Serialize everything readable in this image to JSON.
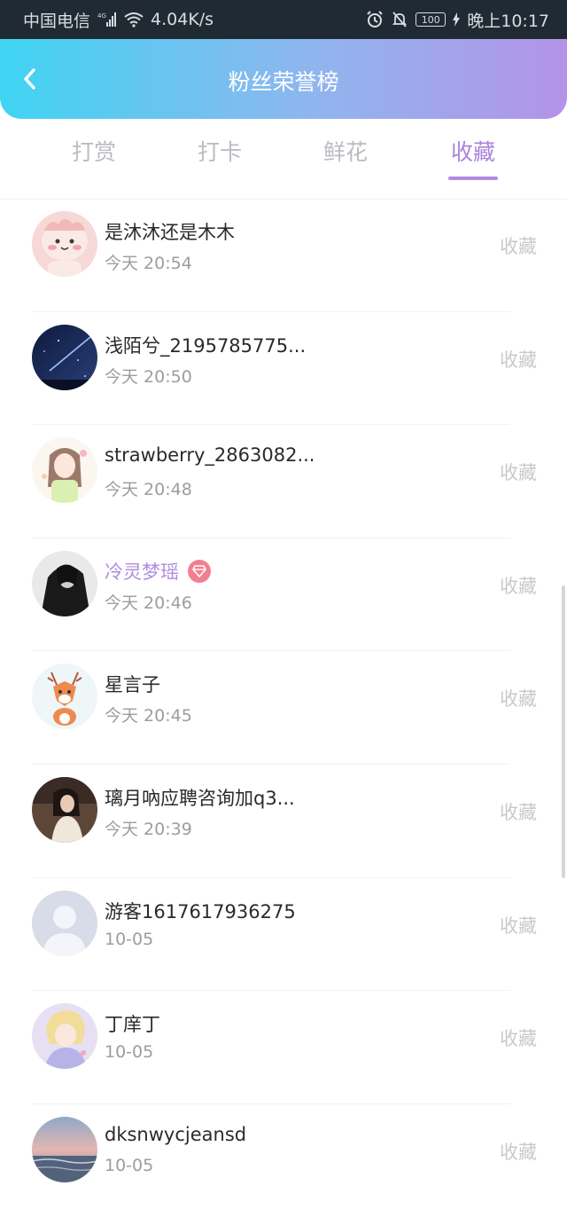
{
  "status_bar": {
    "carrier": "中国电信",
    "network": "4G",
    "speed": "4.04K/s",
    "battery": "100",
    "time": "晚上10:17"
  },
  "header": {
    "title": "粉丝荣誉榜",
    "back_icon": "chevron-left-icon"
  },
  "tabs": [
    {
      "label": "打赏",
      "active": false
    },
    {
      "label": "打卡",
      "active": false
    },
    {
      "label": "鲜花",
      "active": false
    },
    {
      "label": "收藏",
      "active": true
    }
  ],
  "fans": [
    {
      "name": "是沐沐还是木木",
      "time": "今天 20:54",
      "action": "收藏"
    },
    {
      "name": "浅陌兮_2195785775...",
      "time": "今天 20:50",
      "action": "收藏"
    },
    {
      "name": "strawberry_2863082...",
      "time": "今天 20:48",
      "action": "收藏"
    },
    {
      "name": "冷灵梦瑶",
      "time": "今天 20:46",
      "action": "收藏",
      "vip": true
    },
    {
      "name": "星言子",
      "time": "今天 20:45",
      "action": "收藏"
    },
    {
      "name": "璃月吶应聘咨询加q3...",
      "time": "今天 20:39",
      "action": "收藏"
    },
    {
      "name": "游客1617617936275",
      "time": "10-05",
      "action": "收藏"
    },
    {
      "name": "丁庠丁",
      "time": "10-05",
      "action": "收藏"
    },
    {
      "name": "dksnwycjeansd",
      "time": "10-05",
      "action": "收藏"
    }
  ],
  "colors": {
    "header_gradient_start": "#3fd4f2",
    "header_gradient_end": "#b493e8",
    "active_tab": "#a984dd",
    "vip_name": "#b08bdf",
    "vip_badge": "#f27f8f"
  }
}
